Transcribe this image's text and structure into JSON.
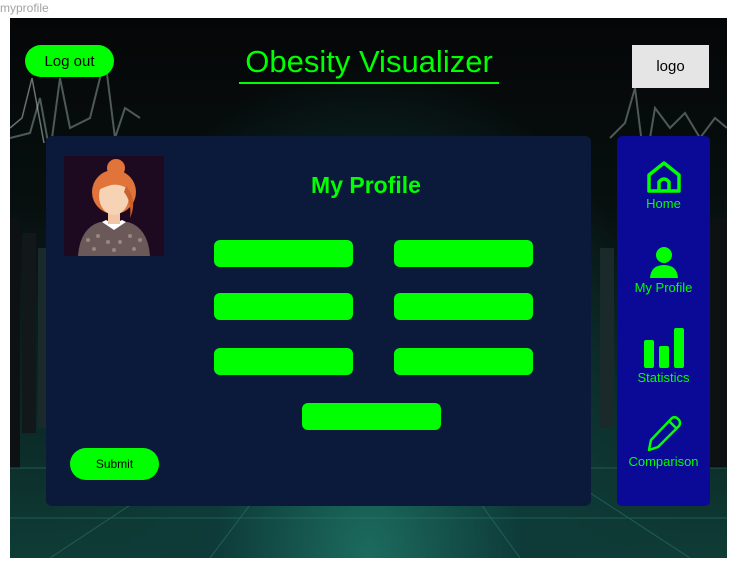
{
  "page_label": "myprofile",
  "header": {
    "logout_label": "Log out",
    "title": "Obesity Visualizer",
    "logo_label": "logo"
  },
  "profile": {
    "title": "My Profile",
    "avatar_icon": "woman-avatar",
    "field_count_visible": 7,
    "submit_label": "Submit"
  },
  "sidebar": {
    "items": [
      {
        "label": "Home",
        "icon": "home-icon"
      },
      {
        "label": "My Profile",
        "icon": "user-icon"
      },
      {
        "label": "Statistics",
        "icon": "bar-chart-icon"
      },
      {
        "label": "Comparison",
        "icon": "pencil-icon"
      }
    ]
  },
  "colors": {
    "accent": "#00ff00",
    "panel": "#0b1a3a",
    "sidebar": "#0a0a96",
    "logo_bg": "#e5e5e5"
  }
}
